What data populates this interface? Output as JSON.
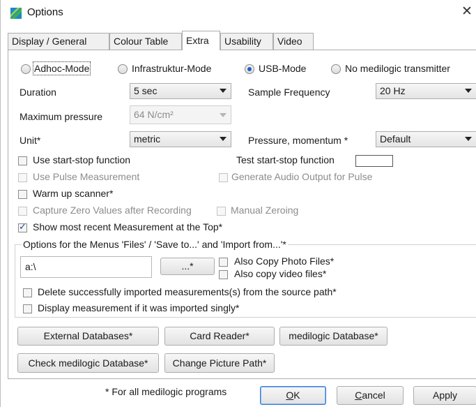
{
  "window": {
    "title": "Options",
    "icon": "medilogic-app-icon",
    "close_glyph": "✕"
  },
  "tabs": [
    {
      "label": "Display / General",
      "active": false
    },
    {
      "label": "Colour Table",
      "active": false
    },
    {
      "label": "Extra",
      "active": true
    },
    {
      "label": "Usability",
      "active": false
    },
    {
      "label": "Video",
      "active": false
    }
  ],
  "mode": {
    "options": [
      "Adhoc-Mode",
      "Infrastruktur-Mode",
      "USB-Mode",
      "No medilogic transmitter"
    ],
    "selected": "USB-Mode"
  },
  "settings": {
    "duration_label": "Duration",
    "duration_value": "5 sec",
    "sample_frequency_label": "Sample Frequency",
    "sample_frequency_value": "20 Hz",
    "max_pressure_label": "Maximum pressure",
    "max_pressure_value": "64 N/cm²",
    "unit_label": "Unit*",
    "unit_value": "metric",
    "pressure_momentum_label": "Pressure, momentum *",
    "pressure_momentum_value": "Default"
  },
  "checkboxes": {
    "use_start_stop": {
      "label": "Use start-stop function",
      "checked": false,
      "enabled": true
    },
    "test_start_stop_label": "Test start-stop function",
    "use_pulse": {
      "label": "Use Pulse Measurement",
      "checked": false,
      "enabled": false
    },
    "generate_audio": {
      "label": "Generate Audio Output for Pulse",
      "checked": false,
      "enabled": false
    },
    "warm_up": {
      "label": "Warm up scanner*",
      "checked": false,
      "enabled": true
    },
    "capture_zero": {
      "label": "Capture Zero Values after Recording",
      "checked": false,
      "enabled": false
    },
    "manual_zeroing": {
      "label": "Manual Zeroing",
      "checked": false,
      "enabled": false
    },
    "show_recent": {
      "label": "Show most recent Measurement at the Top*",
      "checked": true,
      "enabled": true
    }
  },
  "import_group": {
    "title": "Options for the Menus 'Files' / 'Save to...' and 'Import from...'*",
    "path_value": "a:\\",
    "browse_label": "...*",
    "also_copy_photo": "Also Copy Photo Files*",
    "also_copy_video": "Also copy video files*",
    "delete_imported": "Delete successfully imported  measurements(s) from the source path*",
    "display_if_single": "Display measurement if it was imported singly*"
  },
  "buttons": {
    "external_databases": "External Databases*",
    "card_reader": "Card Reader*",
    "medilogic_database": "medilogic Database*",
    "check_medilogic_database": "Check medilogic Database*",
    "change_picture_path": "Change Picture Path*"
  },
  "footer": {
    "note": "* For all medilogic programs",
    "ok_prefix": "",
    "ok_ul": "O",
    "ok_rest": "K",
    "cancel_ul": "C",
    "cancel_rest": "ancel",
    "apply": "Apply"
  },
  "colors": {
    "accent": "#1f5fcf",
    "default_button_border": "#3c7fd6",
    "disabled_text": "#8c8c8c"
  }
}
